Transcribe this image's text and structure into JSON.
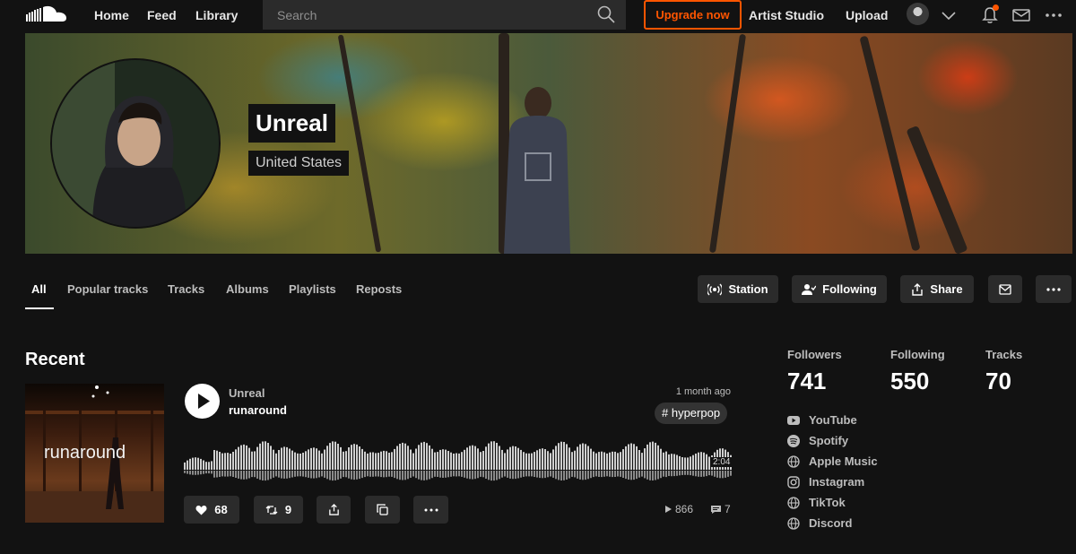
{
  "nav": {
    "home": "Home",
    "feed": "Feed",
    "library": "Library",
    "search_placeholder": "Search",
    "upgrade": "Upgrade now",
    "artist_studio": "Artist Studio",
    "upload": "Upload"
  },
  "profile": {
    "name": "Unreal",
    "country": "United States"
  },
  "tabs": [
    "All",
    "Popular tracks",
    "Tracks",
    "Albums",
    "Playlists",
    "Reposts"
  ],
  "actions": {
    "station": "Station",
    "following": "Following",
    "share": "Share"
  },
  "recent": {
    "heading": "Recent",
    "artwork_text": "runaround",
    "user": "Unreal",
    "title": "runaround",
    "time": "1 month ago",
    "tag": "# hyperpop",
    "duration": "2:04",
    "likes": "68",
    "reposts": "9",
    "plays": "866",
    "comments": "7"
  },
  "stats": {
    "followers_label": "Followers",
    "followers": "741",
    "following_label": "Following",
    "following": "550",
    "tracks_label": "Tracks",
    "tracks": "70"
  },
  "links": [
    "YouTube",
    "Spotify",
    "Apple Music",
    "Instagram",
    "TikTok",
    "Discord"
  ],
  "colors": {
    "accent": "#ff5500",
    "background": "#121212",
    "button": "#2b2b2b"
  }
}
